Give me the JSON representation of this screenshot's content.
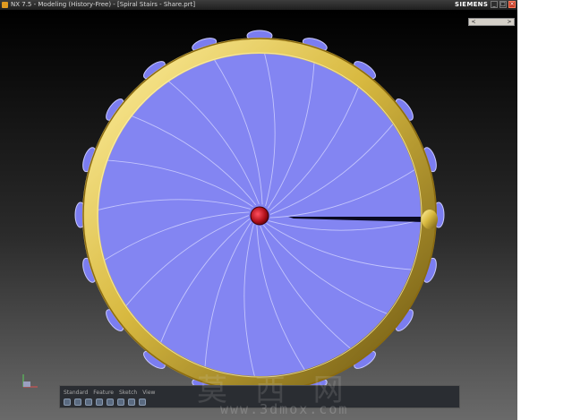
{
  "window": {
    "title": "NX 7.5 - Modeling (History-Free) - [Spiral Stairs - Share.prt]",
    "brand": "SIEMENS",
    "buttons": {
      "minimize": "_",
      "maximize": "□",
      "close": "×"
    }
  },
  "view_nav": {
    "left": "<",
    "right": ">"
  },
  "viewport": {
    "background_top": "#000000",
    "background_bottom": "#6a6a6a",
    "model": {
      "name": "spiral staircase (top view)",
      "step_count": 20,
      "colors": {
        "steps": "#7b7df0",
        "step_edges": "#cfd0ff",
        "handrail": "#d8b940",
        "handrail_highlight": "#fff0a0",
        "column": "#b0101a"
      }
    }
  },
  "toolbar": {
    "labels": [
      "Standard",
      "Feature",
      "Sketch",
      "View"
    ],
    "icons": [
      "select-icon",
      "hide-icon",
      "fit-icon",
      "rotate-icon",
      "shade-icon",
      "measure-icon",
      "snap-icon",
      "layer-icon"
    ]
  },
  "watermark": {
    "text": "莫 西 网",
    "url": "www.3dmox.com"
  }
}
